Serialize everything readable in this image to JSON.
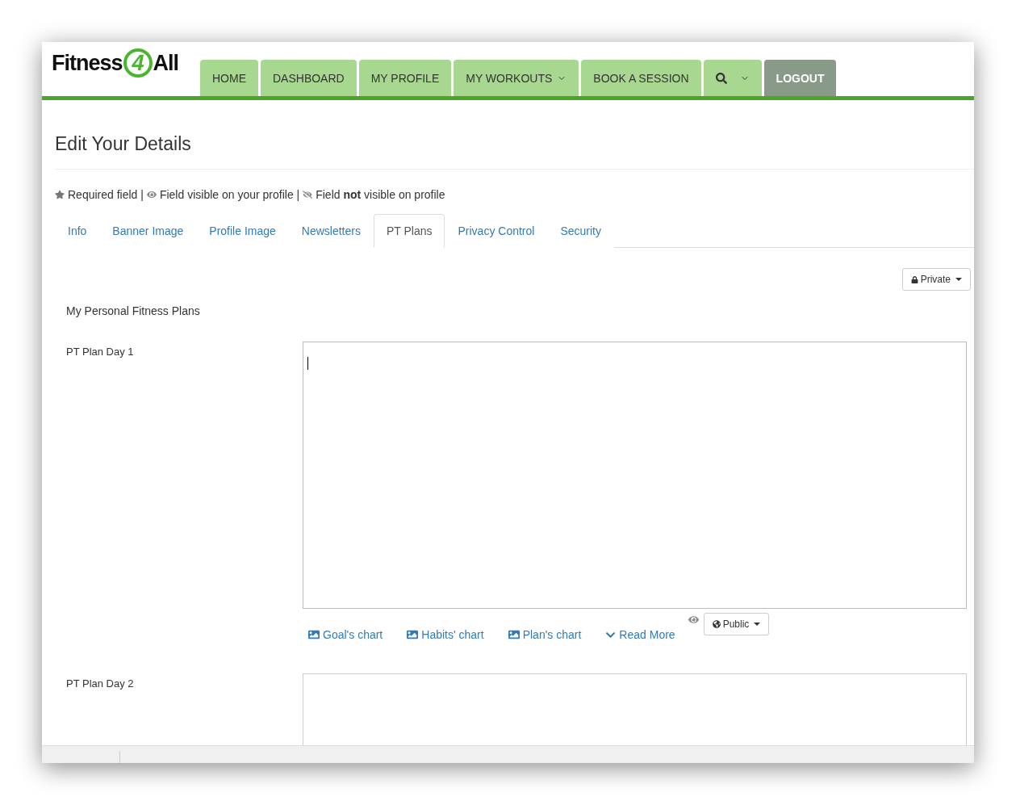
{
  "logo": {
    "before": "Fitness",
    "mark": "4",
    "after": "All"
  },
  "nav": [
    {
      "label": "HOME",
      "kind": "link"
    },
    {
      "label": "DASHBOARD",
      "kind": "link"
    },
    {
      "label": "MY PROFILE",
      "kind": "link"
    },
    {
      "label": "MY WORKOUTS",
      "kind": "dropdown"
    },
    {
      "label": "BOOK A SESSION",
      "kind": "link"
    },
    {
      "kind": "search"
    },
    {
      "label": "LOGOUT",
      "kind": "logout"
    }
  ],
  "page_title": "Edit Your Details",
  "legend": [
    {
      "kind": "star",
      "text": "Required field |"
    },
    {
      "kind": "eye",
      "text": "Field visible on your profile |"
    },
    {
      "kind": "eye-off",
      "text": "Field **not** visible on profile"
    }
  ],
  "tabs": [
    {
      "label": "Info",
      "selected": false
    },
    {
      "label": "Banner Image",
      "selected": false
    },
    {
      "label": "Profile Image",
      "selected": false
    },
    {
      "label": "Newsletters",
      "selected": false
    },
    {
      "label": "PT Plans",
      "selected": true
    },
    {
      "label": "Privacy Control",
      "selected": false
    },
    {
      "label": "Security",
      "selected": false
    }
  ],
  "section_privacy": {
    "label": "Private",
    "kind": "lock"
  },
  "section_title": "My Personal Fitness Plans",
  "fields": [
    {
      "label": "PT Plan Day 1",
      "focused": true,
      "links": [
        {
          "kind": "image",
          "text": "Goal's chart"
        },
        {
          "kind": "image",
          "text": "Habits' chart"
        },
        {
          "kind": "image",
          "text": "Plan's chart"
        },
        {
          "kind": "chevron",
          "text": "Read More"
        }
      ],
      "privacy": {
        "label": "Public",
        "kind": "globe"
      }
    },
    {
      "label": "PT Plan Day 2",
      "focused": false
    }
  ]
}
